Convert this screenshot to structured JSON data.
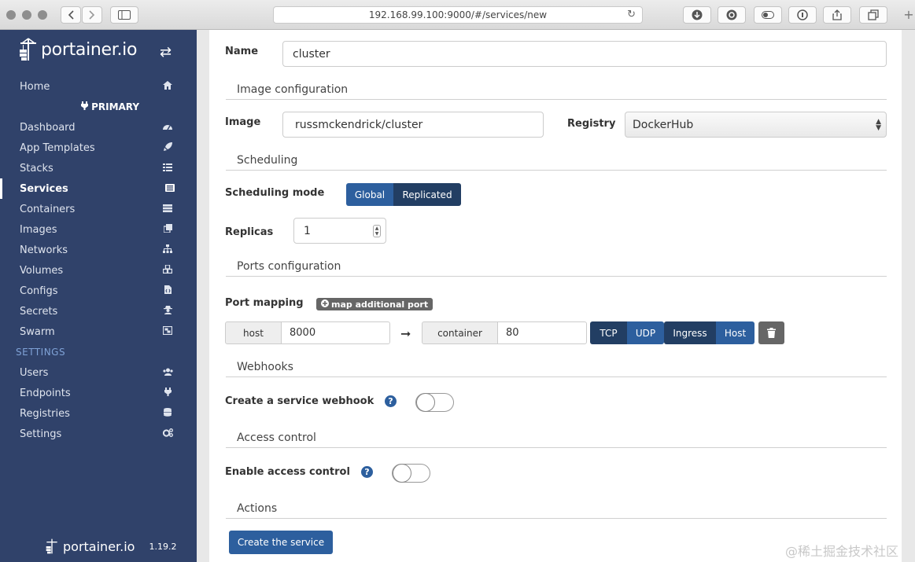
{
  "browser": {
    "url": "192.168.99.100:9000/#/services/new",
    "new_tab_symbol": "+"
  },
  "sidebar": {
    "brand": "portainer.io",
    "home_label": "Home",
    "endpoint_label": "PRIMARY",
    "items": [
      {
        "label": "Dashboard",
        "icon": "tachometer-icon"
      },
      {
        "label": "App Templates",
        "icon": "rocket-icon"
      },
      {
        "label": "Stacks",
        "icon": "th-list-icon"
      },
      {
        "label": "Services",
        "icon": "list-alt-icon",
        "active": true
      },
      {
        "label": "Containers",
        "icon": "server-icon"
      },
      {
        "label": "Images",
        "icon": "clone-icon"
      },
      {
        "label": "Networks",
        "icon": "sitemap-icon"
      },
      {
        "label": "Volumes",
        "icon": "cubes-icon"
      },
      {
        "label": "Configs",
        "icon": "file-code-icon"
      },
      {
        "label": "Secrets",
        "icon": "user-secret-icon"
      },
      {
        "label": "Swarm",
        "icon": "object-group-icon"
      }
    ],
    "settings_header": "SETTINGS",
    "settings_items": [
      {
        "label": "Users",
        "icon": "users-icon"
      },
      {
        "label": "Endpoints",
        "icon": "plug-icon"
      },
      {
        "label": "Registries",
        "icon": "database-icon"
      },
      {
        "label": "Settings",
        "icon": "cogs-icon"
      }
    ],
    "footer_brand": "portainer.io",
    "version": "1.19.2"
  },
  "form": {
    "name_label": "Name",
    "name_value": "cluster",
    "image_section": "Image configuration",
    "image_label": "Image",
    "image_value": "russmckendrick/cluster",
    "registry_label": "Registry",
    "registry_value": "DockerHub",
    "scheduling_section": "Scheduling",
    "scheduling_mode_label": "Scheduling mode",
    "mode_global": "Global",
    "mode_replicated": "Replicated",
    "replicas_label": "Replicas",
    "replicas_value": "1",
    "ports_section": "Ports configuration",
    "port_mapping_label": "Port mapping",
    "map_port_button": "map additional port",
    "host_addon": "host",
    "host_value": "8000",
    "container_addon": "container",
    "container_value": "80",
    "proto_tcp": "TCP",
    "proto_udp": "UDP",
    "mode_ingress": "Ingress",
    "mode_host": "Host",
    "webhooks_section": "Webhooks",
    "webhook_label": "Create a service webhook",
    "webhook_enabled": false,
    "access_section": "Access control",
    "access_label": "Enable access control",
    "access_enabled": false,
    "actions_section": "Actions",
    "create_button": "Create the service"
  },
  "watermark": "@稀土掘金技术社区"
}
